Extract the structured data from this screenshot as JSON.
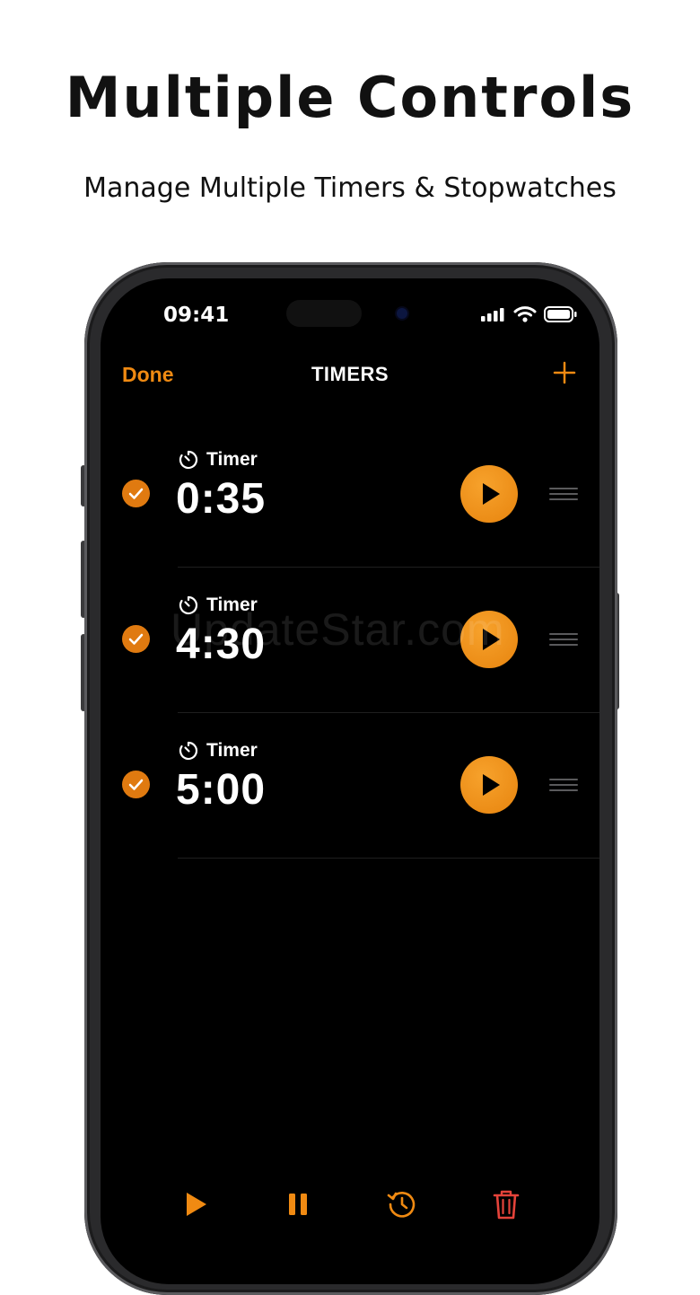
{
  "promo": {
    "headline": "Multiple Controls",
    "subheadline": "Manage Multiple Timers & Stopwatches"
  },
  "status_bar": {
    "time": "09:41",
    "icons": [
      "cellular-signal-icon",
      "wifi-icon",
      "battery-icon"
    ]
  },
  "nav": {
    "done_label": "Done",
    "title": "TIMERS",
    "add_icon": "plus-icon"
  },
  "timers": [
    {
      "label": "Timer",
      "time": "0:35",
      "selected": true
    },
    {
      "label": "Timer",
      "time": "4:30",
      "selected": true
    },
    {
      "label": "Timer",
      "time": "5:00",
      "selected": true
    }
  ],
  "watermark": "UpdateStar.com",
  "toolbar": {
    "items": [
      "play-all-icon",
      "pause-all-icon",
      "reset-history-icon",
      "trash-icon"
    ]
  },
  "colors": {
    "accent": "#f08a12",
    "delete": "#e5433a",
    "background": "#000000"
  }
}
